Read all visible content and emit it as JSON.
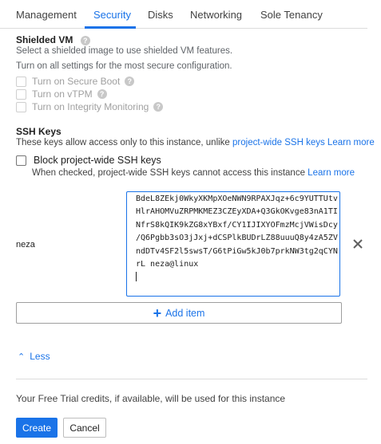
{
  "tabs": [
    {
      "label": "Management"
    },
    {
      "label": "Security"
    },
    {
      "label": "Disks"
    },
    {
      "label": "Networking"
    },
    {
      "label": "Sole Tenancy"
    }
  ],
  "active_tab": "Security",
  "shielded_vm": {
    "title": "Shielded VM",
    "desc1": "Select a shielded image to use shielded VM features.",
    "desc2": "Turn on all settings for the most secure configuration.",
    "options": [
      {
        "label": "Turn on Secure Boot",
        "checked": false,
        "disabled": true
      },
      {
        "label": "Turn on vTPM",
        "checked": false,
        "disabled": true
      },
      {
        "label": "Turn on Integrity Monitoring",
        "checked": false,
        "disabled": true
      }
    ]
  },
  "ssh_keys": {
    "title": "SSH Keys",
    "desc_prefix": "These keys allow access only to this instance, unlike ",
    "desc_link": "project-wide SSH keys",
    "learn_more": "Learn more",
    "block_label": "Block project-wide SSH keys",
    "block_checked": false,
    "block_desc": "When checked, project-wide SSH keys cannot access this instance",
    "items": [
      {
        "user": "neza",
        "key_lines": [
          "BdeL8ZEkj0WkyXKMpXOeNWN9RPAXJqz+6c9YUTTUtv",
          "HlrAHOMVuZRPMKMEZ3CZEyXDA+Q3GkOKvge83nA1TI",
          "NfrS8kQIK9kZG8xYBxf/CY1IJIXYOFmzMcjVWisDcy",
          "/Q6Pgbb3sO3jJxj+dCSPlkBUDrLZ88uuuQ8y4zA5ZV",
          "ndDTv4SF2l5swsT/G6tPiGw5kJ0b7prkNW3tg2qCYN",
          "rL neza@linux"
        ]
      }
    ],
    "add_item_label": "Add item"
  },
  "less_label": "Less",
  "trial_text": "Your Free Trial credits, if available, will be used for this instance",
  "buttons": {
    "create": "Create",
    "cancel": "Cancel"
  },
  "colors": {
    "accent": "#1a73e8",
    "disabled_text": "#a0a0a0",
    "divider": "#dcdcdc"
  },
  "icons": {
    "help": "help-circle-icon",
    "remove": "close-icon",
    "add": "plus-icon",
    "less": "chevron-up-icon"
  }
}
